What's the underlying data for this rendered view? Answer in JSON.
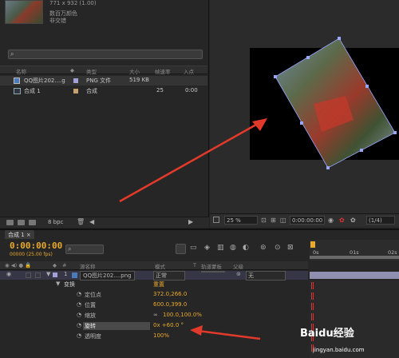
{
  "project": {
    "item_info": {
      "dims": "771 x 932 (1.00)",
      "colors": "数百万颜色",
      "interlace": "非交错"
    },
    "search": {
      "placeholder": ""
    },
    "columns": [
      "名称",
      "类型",
      "大小",
      "帧速率",
      "入点"
    ],
    "items": [
      {
        "name": "QQ图片202....g",
        "type": "PNG 文件",
        "size": "519 KB",
        "fps": "",
        "in": ""
      },
      {
        "name": "合成 1",
        "type": "合成",
        "size": "",
        "fps": "25",
        "in": "0:00"
      }
    ],
    "bpc": "8 bpc"
  },
  "viewer": {
    "zoom": "25 %",
    "timecode": "0:00:00:00",
    "resolution": "(1/4)"
  },
  "timeline": {
    "tab": "合成 1",
    "timecode": "0:00:00:00",
    "fps": "00000 (25.00 fps)",
    "columns": [
      "源名称",
      "模式",
      "T",
      "轨道蒙板",
      "父级"
    ],
    "ruler": [
      "0s",
      "01s",
      "02s"
    ],
    "layer": {
      "num": "1",
      "name": "QQ图片202....png",
      "mode": "正常",
      "parent": "无"
    },
    "transform": {
      "label": "变换",
      "reset": "重置"
    },
    "props": [
      {
        "name": "定位点",
        "value": "372.0,266.0"
      },
      {
        "name": "位置",
        "value": "600.0,399.0"
      },
      {
        "name": "缩放",
        "value": "100.0,100.0%"
      },
      {
        "name": "旋转",
        "value": "0x +60.0 °"
      },
      {
        "name": "透明度",
        "value": "100%"
      }
    ]
  },
  "watermark": {
    "brand": "Baidu经验",
    "url": "jingyan.baidu.com"
  },
  "colors": {
    "accent": "#e8a92d",
    "arrow": "#e23a2a"
  }
}
